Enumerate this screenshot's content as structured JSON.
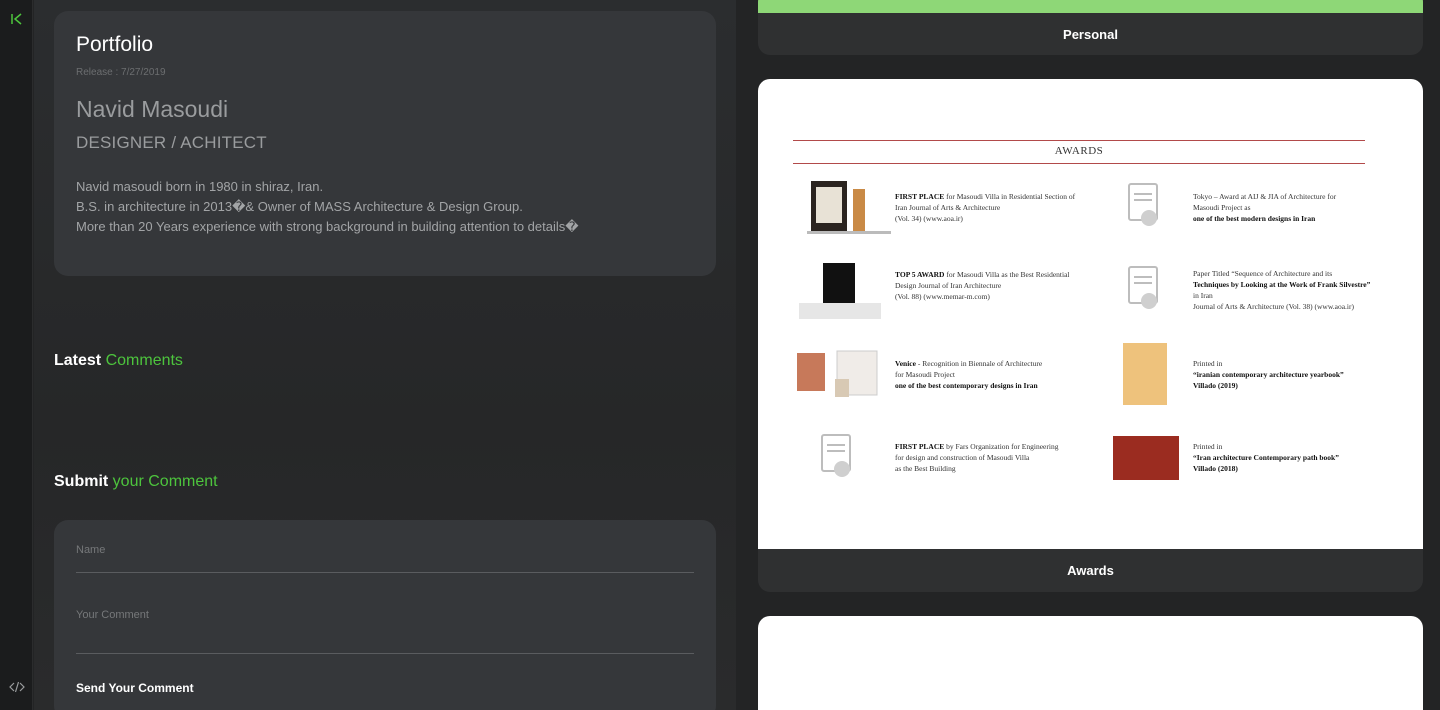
{
  "profile": {
    "title": "Portfolio",
    "release": "Release : 7/27/2019",
    "name": "Navid Masoudi",
    "role": "DESIGNER / ACHITECT",
    "bio": [
      "Navid masoudi born in 1980 in shiraz, Iran.",
      "B.S. in architecture in 2013�& Owner of MASS Architecture & Design Group.",
      "More than 20 Years experience with strong background in building attention to details�"
    ]
  },
  "latest_comments": {
    "prefix": "Latest",
    "accent": "Comments"
  },
  "submit_comment": {
    "prefix": "Submit",
    "accent": "your Comment"
  },
  "form": {
    "name_label": "Name",
    "comment_label": "Your Comment",
    "send_label": "Send Your Comment"
  },
  "gallery": {
    "personal_label": "Personal",
    "awards_label": "Awards",
    "awards_doc": {
      "heading": "AWARDS",
      "entries": [
        {
          "bold": "FIRST PLACE",
          "rest": " for Masoudi Villa in Residential Section of",
          "l2": "Iran Journal of Arts & Architecture",
          "l3": "(Vol. 34) (www.aoa.ir)",
          "l3bold": false
        },
        {
          "bold": "",
          "rest": "Tokyo – Award at AIJ & JIA of Architecture for",
          "l2": "Masoudi Project as",
          "l3": "one of the best modern designs in Iran",
          "l3bold": true
        },
        {
          "bold": "TOP 5 AWARD",
          "rest": " for Masoudi Villa as the Best Residential",
          "l2": "Design Journal of Iran Architecture",
          "l3": "(Vol. 88) (www.memar-m.com)",
          "l3bold": false
        },
        {
          "bold": "",
          "rest": "Paper Titled “Sequence of Architecture and its",
          "l2": "Techniques by Looking at the Work of Frank Silvestre”",
          "l3": "in Iran",
          "l4": "Journal of Arts & Architecture (Vol. 38) (www.aoa.ir)",
          "l3bold": false
        },
        {
          "bold": "Venice",
          "rest": " - Recognition in Biennale of Architecture",
          "l2": "for Masoudi Project",
          "l3": "one of the best contemporary designs in Iran",
          "l3bold": true
        },
        {
          "bold": "",
          "rest": "Printed in",
          "l2": "“iranian contemporary architecture yearbook”",
          "l3": "Villado (2019)",
          "l3bold": true
        },
        {
          "bold": "FIRST PLACE",
          "rest": " by Fars Organization for Engineering",
          "l2": "for design and construction of Masoudi Villa",
          "l3": "as the Best Building",
          "l3bold": false
        },
        {
          "bold": "",
          "rest": "Printed in",
          "l2": "“Iran architecture Contemporary path book”",
          "l3": "Villado (2018)",
          "l3bold": true
        }
      ]
    }
  },
  "colors": {
    "accent": "#4dc43d",
    "personal_bar": "#8ed777",
    "award_rule": "#b24a4a"
  },
  "icons": {
    "rail_top": "collapse-left-icon",
    "rail_bottom": "code-icon"
  }
}
